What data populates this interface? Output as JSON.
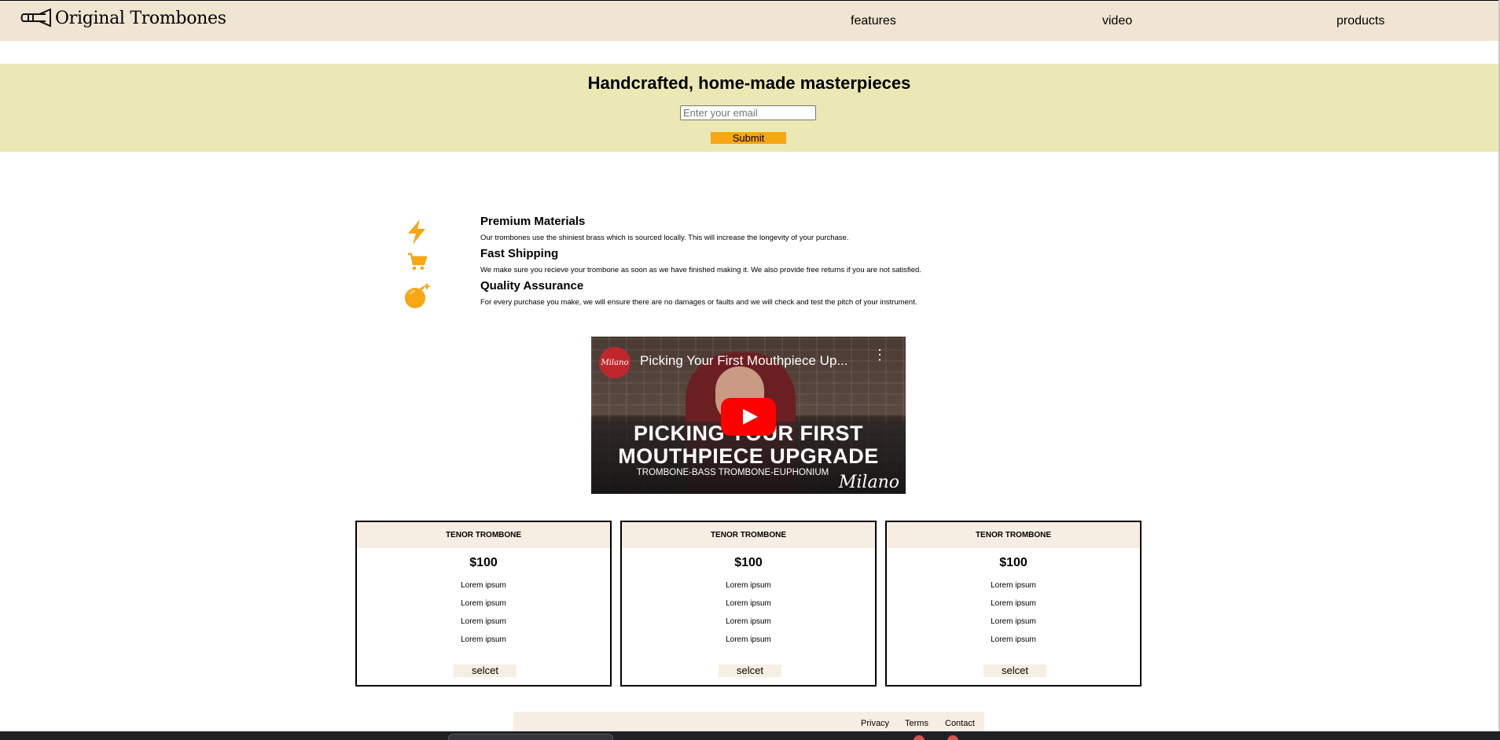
{
  "header": {
    "brand": "Original Trombones",
    "nav": [
      "features",
      "video",
      "products"
    ]
  },
  "hero": {
    "title": "Handcrafted, home-made masterpieces",
    "email_placeholder": "Enter your email",
    "submit_label": "Submit"
  },
  "features": [
    {
      "icon": "lightning-icon",
      "title": "Premium Materials",
      "desc": "Our trombones use the shiniest brass which is sourced locally. This will increase the longevity of your purchase."
    },
    {
      "icon": "cart-icon",
      "title": "Fast Shipping",
      "desc": "We make sure you recieve your trombone as soon as we have finished making it. We also provide free returns if you are not satisfied."
    },
    {
      "icon": "bomb-icon",
      "title": "Quality Assurance",
      "desc": "For every purchase you make, we will ensure there are no damages or faults and we will check and test the pitch of your instrument."
    }
  ],
  "video": {
    "channel": "Milano",
    "title": "Picking Your First Mouthpiece Up...",
    "overlay_line1": "PICKING YOUR FIRST",
    "overlay_line2": "MOUTHPIECE UPGRADE",
    "overlay_sub": "TROMBONE-BASS TROMBONE-EUPHONIUM",
    "brand": "Milano"
  },
  "products": [
    {
      "name": "TENOR TROMBONE",
      "price": "$100",
      "items": [
        "Lorem ipsum",
        "Lorem ipsum",
        "Lorem ipsum",
        "Lorem ipsum"
      ],
      "button": "selcet"
    },
    {
      "name": "TENOR TROMBONE",
      "price": "$100",
      "items": [
        "Lorem ipsum",
        "Lorem ipsum",
        "Lorem ipsum",
        "Lorem ipsum"
      ],
      "button": "selcet"
    },
    {
      "name": "TENOR TROMBONE",
      "price": "$100",
      "items": [
        "Lorem ipsum",
        "Lorem ipsum",
        "Lorem ipsum",
        "Lorem ipsum"
      ],
      "button": "selcet"
    }
  ],
  "footer": {
    "links": [
      "Privacy",
      "Terms",
      "Contact"
    ]
  },
  "colors": {
    "header_bg": "#f0e5d2",
    "hero_bg": "#ebe8b6",
    "accent": "#f7a614",
    "card_header_bg": "#f7eee3"
  }
}
